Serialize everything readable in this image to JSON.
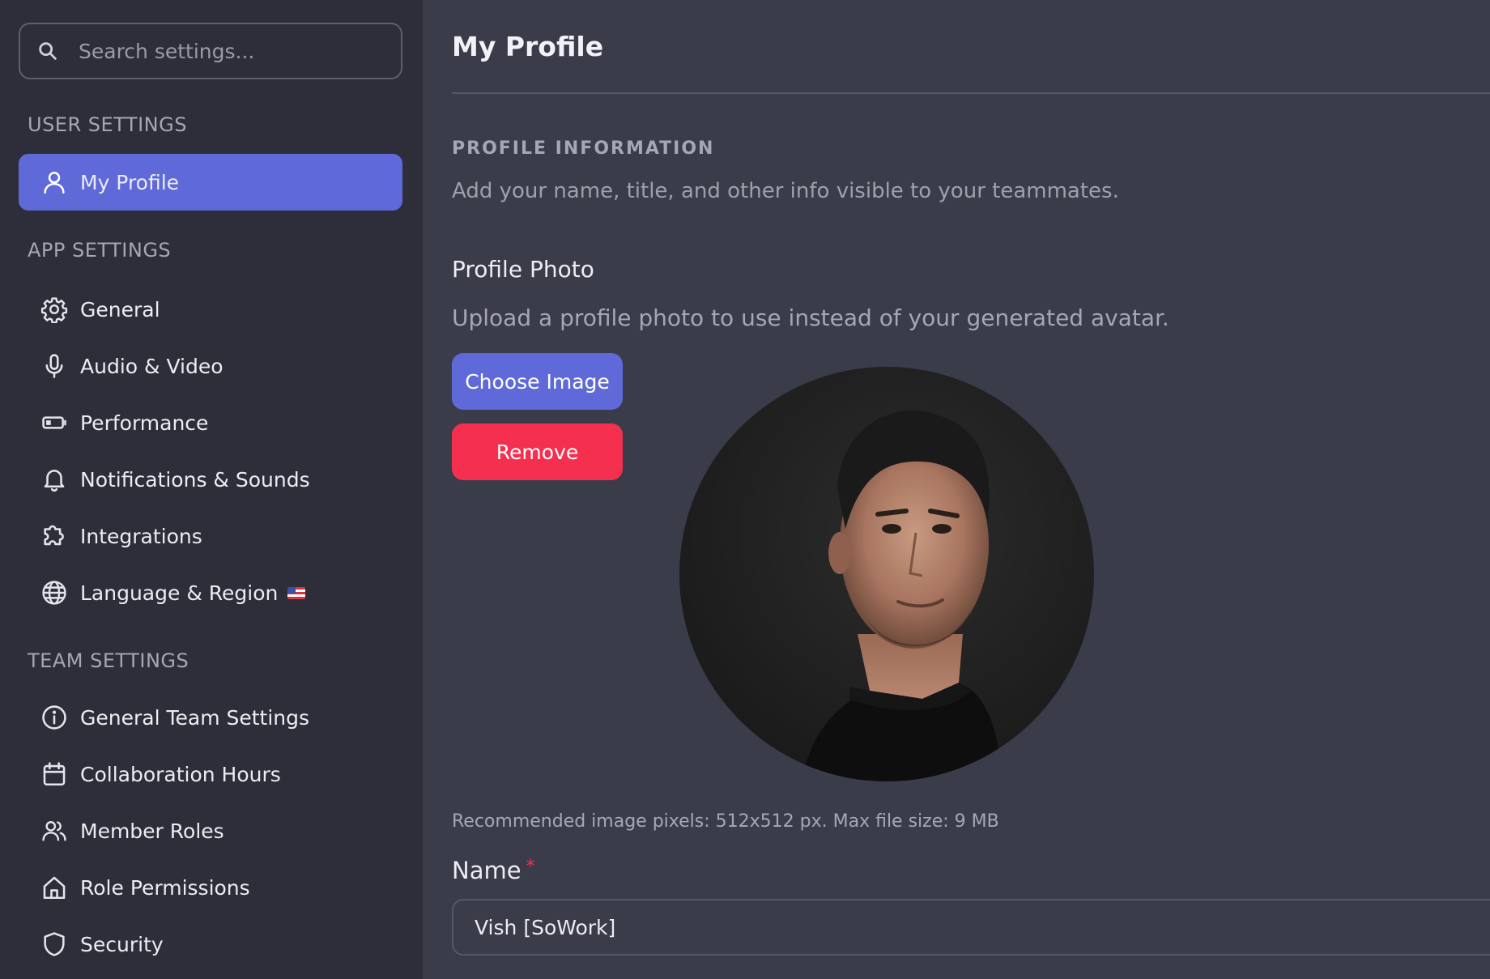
{
  "search": {
    "placeholder": "Search settings..."
  },
  "sidebar": {
    "user_settings_title": "USER SETTINGS",
    "app_settings_title": "APP SETTINGS",
    "team_settings_title": "TEAM SETTINGS",
    "user_items": [
      {
        "label": "My Profile",
        "icon": "user-icon",
        "active": true
      }
    ],
    "app_items": [
      {
        "label": "General",
        "icon": "gear-icon"
      },
      {
        "label": "Audio & Video",
        "icon": "microphone-icon"
      },
      {
        "label": "Performance",
        "icon": "battery-icon"
      },
      {
        "label": "Notifications & Sounds",
        "icon": "bell-icon"
      },
      {
        "label": "Integrations",
        "icon": "puzzle-icon"
      },
      {
        "label": "Language & Region",
        "icon": "globe-icon",
        "flag": "us-flag-icon"
      }
    ],
    "team_items": [
      {
        "label": "General Team Settings",
        "icon": "info-icon"
      },
      {
        "label": "Collaboration Hours",
        "icon": "calendar-icon"
      },
      {
        "label": "Member Roles",
        "icon": "users-icon"
      },
      {
        "label": "Role Permissions",
        "icon": "home-icon"
      },
      {
        "label": "Security",
        "icon": "shield-icon"
      }
    ]
  },
  "main": {
    "title": "My Profile",
    "section_heading": "PROFILE INFORMATION",
    "section_description": "Add your name, title, and other info visible to your teammates.",
    "photo_title": "Profile Photo",
    "photo_description": "Upload a profile photo to use instead of your generated avatar.",
    "choose_button": "Choose Image",
    "remove_button": "Remove",
    "image_hint": "Recommended image pixels: 512x512 px. Max file size: 9 MB",
    "name_label": "Name",
    "name_required_marker": "*",
    "name_value": "Vish [SoWork]"
  },
  "colors": {
    "accent": "#5f6ad8",
    "danger": "#f5304e",
    "sidebar_bg": "#2e2e3a",
    "main_bg": "#3b3c4a"
  }
}
